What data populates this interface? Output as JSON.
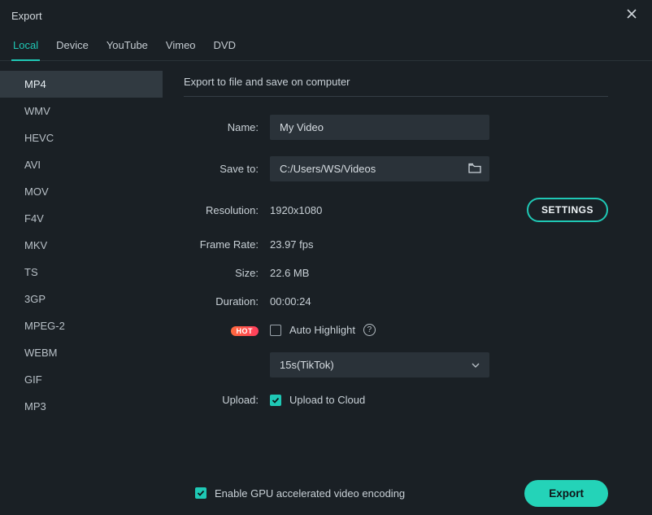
{
  "window": {
    "title": "Export"
  },
  "tabs": [
    "Local",
    "Device",
    "YouTube",
    "Vimeo",
    "DVD"
  ],
  "active_tab": "Local",
  "formats": [
    "MP4",
    "WMV",
    "HEVC",
    "AVI",
    "MOV",
    "F4V",
    "MKV",
    "TS",
    "3GP",
    "MPEG-2",
    "WEBM",
    "GIF",
    "MP3"
  ],
  "selected_format": "MP4",
  "section_title": "Export to file and save on computer",
  "labels": {
    "name": "Name:",
    "save_to": "Save to:",
    "resolution": "Resolution:",
    "frame_rate": "Frame Rate:",
    "size": "Size:",
    "duration": "Duration:",
    "upload": "Upload:"
  },
  "values": {
    "name": "My Video",
    "save_to": "C:/Users/WS/Videos",
    "resolution": "1920x1080",
    "frame_rate": "23.97 fps",
    "size": "22.6 MB",
    "duration": "00:00:24"
  },
  "settings_btn": "SETTINGS",
  "hot_badge": "HOT",
  "auto_highlight": {
    "label": "Auto Highlight",
    "checked": false
  },
  "highlight_preset": "15s(TikTok)",
  "upload_to_cloud": {
    "label": "Upload to Cloud",
    "checked": true
  },
  "gpu": {
    "label": "Enable GPU accelerated video encoding",
    "checked": true
  },
  "export_btn": "Export",
  "colors": {
    "accent": "#1fc8b5",
    "bg": "#1a2025",
    "input_bg": "#2a3239"
  }
}
